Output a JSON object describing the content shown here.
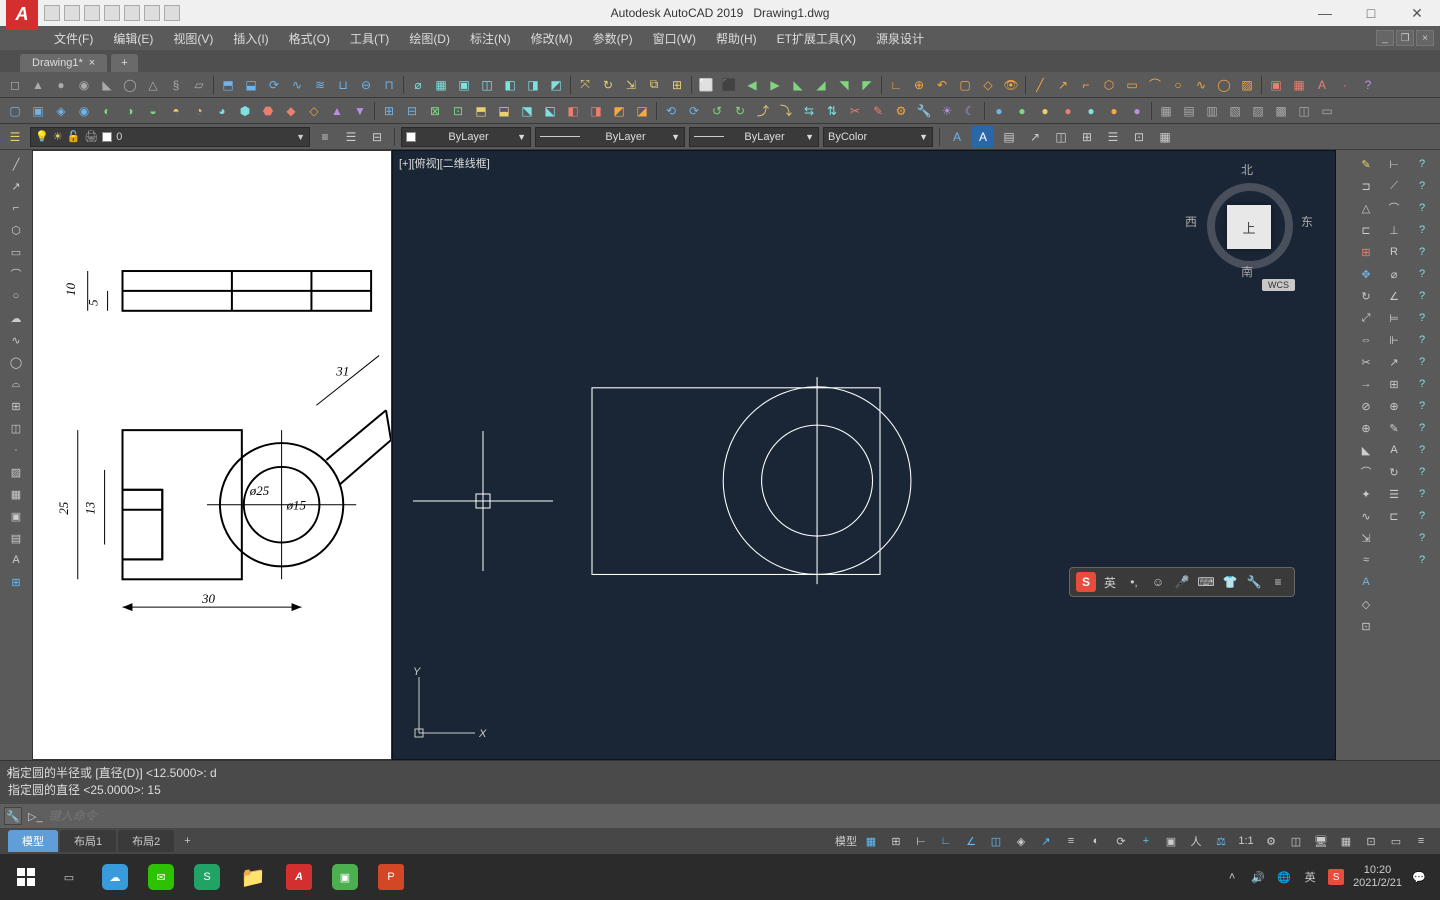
{
  "title": {
    "app": "Autodesk AutoCAD 2019",
    "file": "Drawing1.dwg"
  },
  "app_icon_letter": "A",
  "menubar": [
    "文件(F)",
    "编辑(E)",
    "视图(V)",
    "插入(I)",
    "格式(O)",
    "工具(T)",
    "绘图(D)",
    "标注(N)",
    "修改(M)",
    "参数(P)",
    "窗口(W)",
    "帮助(H)",
    "ET扩展工具(X)",
    "源泉设计"
  ],
  "filetab": {
    "name": "Drawing1*",
    "add": "+"
  },
  "layer": {
    "current": "0"
  },
  "prop": {
    "color_label": "ByLayer",
    "ltype": "ByLayer",
    "lweight": "ByLayer",
    "plot": "ByColor"
  },
  "viewport_label": "[+][俯视][二维线框]",
  "viewcube": {
    "top": "上",
    "n": "北",
    "s": "南",
    "e": "东",
    "w": "西",
    "wcs": "WCS"
  },
  "ucs": {
    "x": "X",
    "y": "Y"
  },
  "cmd_history": [
    "指定圆的半径或 [直径(D)] <12.5000>: d",
    "指定圆的直径 <25.0000>: 15"
  ],
  "cmd_placeholder": "键入命令",
  "cmd_close": "×",
  "layout_tabs": {
    "model": "模型",
    "l1": "布局1",
    "l2": "布局2",
    "add": "+"
  },
  "status": {
    "model": "模型",
    "scale": "1:1"
  },
  "ime": {
    "logo": "S",
    "lang": "英"
  },
  "tray": {
    "ime": "英",
    "time": "10:20",
    "date": "2021/2/21"
  },
  "ref_dims": {
    "d10": "10",
    "d5": "5",
    "d25": "25",
    "d13": "13",
    "d30": "30",
    "d31": "31",
    "phi25": "ø25",
    "phi15": "ø15"
  },
  "win_btns": {
    "min": "—",
    "max": "□",
    "close": "✕"
  }
}
